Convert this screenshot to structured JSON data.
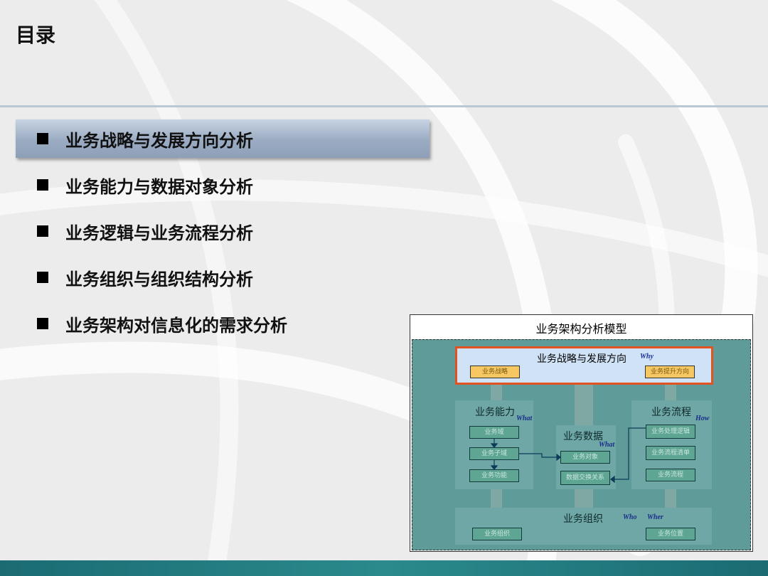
{
  "slide": {
    "title": "目录"
  },
  "menu": {
    "items": [
      {
        "label": "业务战略与发展方向分析",
        "active": true
      },
      {
        "label": "业务能力与数据对象分析",
        "active": false
      },
      {
        "label": "业务逻辑与业务流程分析",
        "active": false
      },
      {
        "label": "业务组织与组织结构分析",
        "active": false
      },
      {
        "label": "业务架构对信息化的需求分析",
        "active": false
      }
    ]
  },
  "model": {
    "title": "业务架构分析模型",
    "strategy": {
      "title": "业务战略与发展方向",
      "tag": "Why",
      "nodes": [
        "业务战略",
        "业务提升方向"
      ]
    },
    "capability": {
      "title": "业务能力",
      "tag": "What",
      "nodes": [
        "业务域",
        "业务子域",
        "业务功能"
      ]
    },
    "data": {
      "title": "业务数据",
      "tag": "What",
      "nodes": [
        "业务对象",
        "数据交换关系"
      ]
    },
    "process": {
      "title": "业务流程",
      "tag": "How",
      "nodes": [
        "业务处理逻辑",
        "业务流程清单",
        "业务流程"
      ]
    },
    "organization": {
      "title": "业务组织",
      "tag_who": "Who",
      "tag_where": "Wher",
      "nodes": [
        "业务组织",
        "业务位置"
      ]
    }
  },
  "colors": {
    "active_highlight": "#9aabc2",
    "strategy_border": "#e25321",
    "footer_bar": "#1b6b73"
  }
}
